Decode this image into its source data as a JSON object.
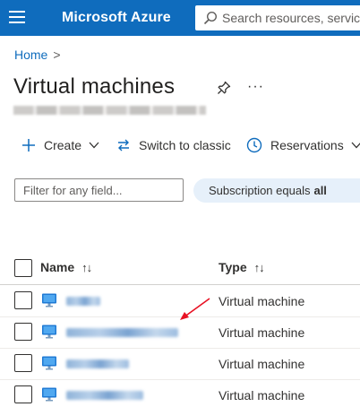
{
  "colors": {
    "brand": "#0f6cbd",
    "link": "#0f6cbd",
    "pill_bg": "#e6f0fa",
    "annotation": "#e81123"
  },
  "topbar": {
    "menu_icon": "hamburger-icon",
    "brand": "Microsoft Azure",
    "search_placeholder": "Search resources, services"
  },
  "breadcrumb": {
    "home": "Home",
    "separator": ">"
  },
  "title": "Virtual machines",
  "title_actions": {
    "pin_icon": "pin-icon",
    "more": "···"
  },
  "toolbar": {
    "create": "Create",
    "switch": "Switch to classic",
    "reservations": "Reservations"
  },
  "filters": {
    "filter_placeholder": "Filter for any field...",
    "pill_prefix": "Subscription equals",
    "pill_value": "all"
  },
  "table": {
    "columns": [
      "Name",
      "Type"
    ],
    "sort_glyph": "↑↓",
    "rows": [
      {
        "type": "Virtual machine"
      },
      {
        "type": "Virtual machine"
      },
      {
        "type": "Virtual machine"
      },
      {
        "type": "Virtual machine"
      }
    ]
  }
}
